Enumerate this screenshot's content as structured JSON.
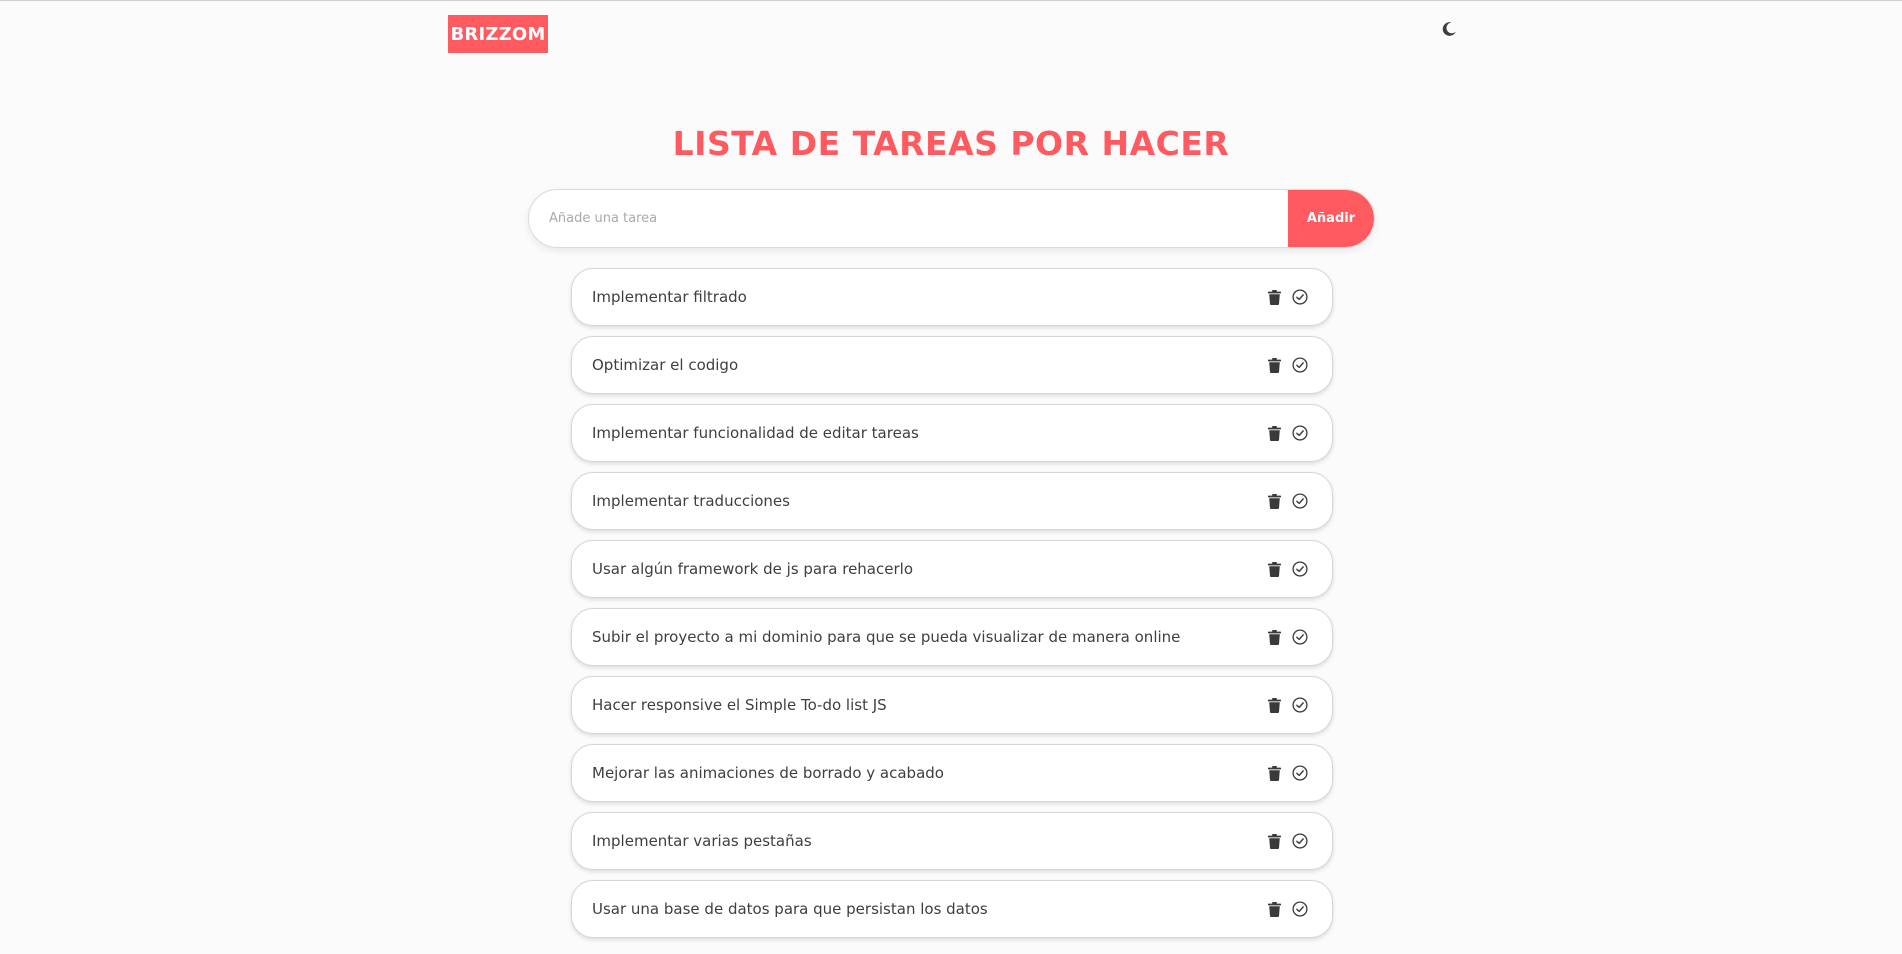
{
  "header": {
    "logo_text": "BRIZZOM",
    "theme_toggle_icon": "moon-icon"
  },
  "main": {
    "title": "LISTA DE TAREAS POR HACER",
    "input_placeholder": "Añade una tarea",
    "input_value": "",
    "add_button_label": "Añadir"
  },
  "tasks": [
    {
      "text": "Implementar filtrado"
    },
    {
      "text": "Optimizar el codigo"
    },
    {
      "text": "Implementar funcionalidad de editar tareas"
    },
    {
      "text": "Implementar traducciones"
    },
    {
      "text": "Usar algún framework de js para rehacerlo"
    },
    {
      "text": "Subir el proyecto a mi dominio para que se pueda visualizar de manera online"
    },
    {
      "text": "Hacer responsive el Simple To-do list JS"
    },
    {
      "text": "Mejorar las animaciones de borrado y acabado"
    },
    {
      "text": "Implementar varias pestañas"
    },
    {
      "text": "Usar una base de datos para que persistan los datos"
    }
  ],
  "task_icons": {
    "delete": "trash-icon",
    "complete": "check-circle-icon"
  },
  "colors": {
    "accent": "#ff5a5f",
    "text": "#3f3f3f",
    "background": "#fbfbfb"
  }
}
